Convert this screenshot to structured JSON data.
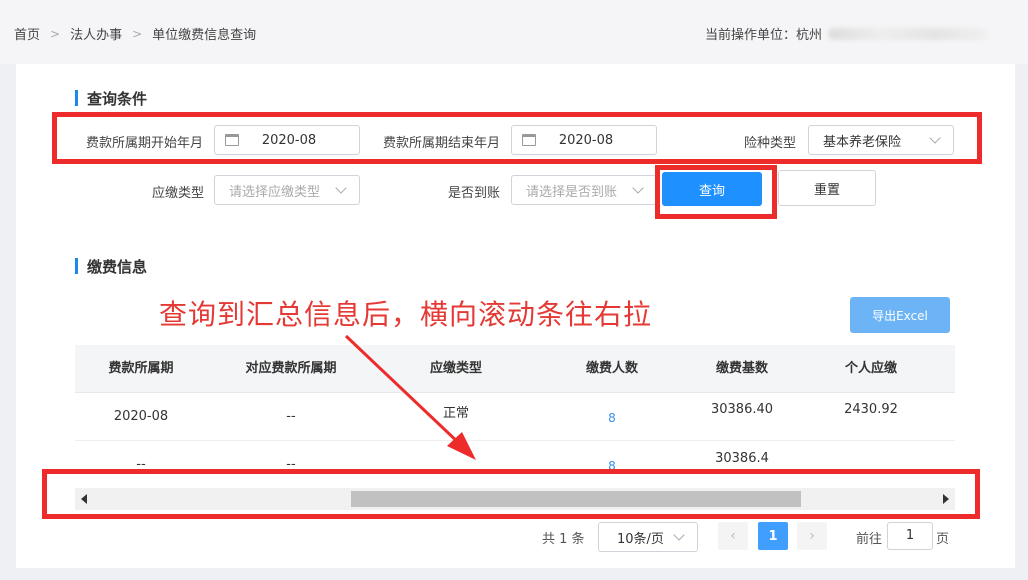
{
  "breadcrumb": [
    "首页",
    "法人办事",
    "单位缴费信息查询"
  ],
  "current_unit": {
    "label": "当前操作单位：杭州"
  },
  "query_section": {
    "title": "查询条件"
  },
  "filters": {
    "start_label": "费款所属期开始年月",
    "start_value": "2020-08",
    "end_label": "费款所属期结束年月",
    "end_value": "2020-08",
    "insurance_label": "险种类型",
    "insurance_value": "基本养老保险",
    "pay_type_label": "应缴类型",
    "pay_type_placeholder": "请选择应缴类型",
    "arrived_label": "是否到账",
    "arrived_placeholder": "请选择是否到账"
  },
  "buttons": {
    "query": "查询",
    "reset": "重置",
    "export": "导出Excel"
  },
  "payment_section": {
    "title": "缴费信息"
  },
  "annotation": "查询到汇总信息后，横向滚动条往右拉",
  "table": {
    "headers": [
      "费款所属期",
      "对应费款所属期",
      "应缴类型",
      "缴费人数",
      "缴费基数",
      "个人应缴"
    ],
    "rows": [
      [
        "2020-08",
        "--",
        "正常",
        "8",
        "30386.40",
        "2430.92"
      ],
      [
        "--",
        "--",
        "",
        "8",
        "30386.4",
        ""
      ]
    ]
  },
  "pagination": {
    "total": "共 1 条",
    "page_size": "10条/页",
    "prev": "‹",
    "current": "1",
    "next": "›",
    "goto_label": "前往",
    "goto_value": "1",
    "page_suffix": "页"
  },
  "colors": {
    "primary": "#1e90ff",
    "annotation": "#e53935",
    "highlight_box": "#ee2b2b"
  }
}
